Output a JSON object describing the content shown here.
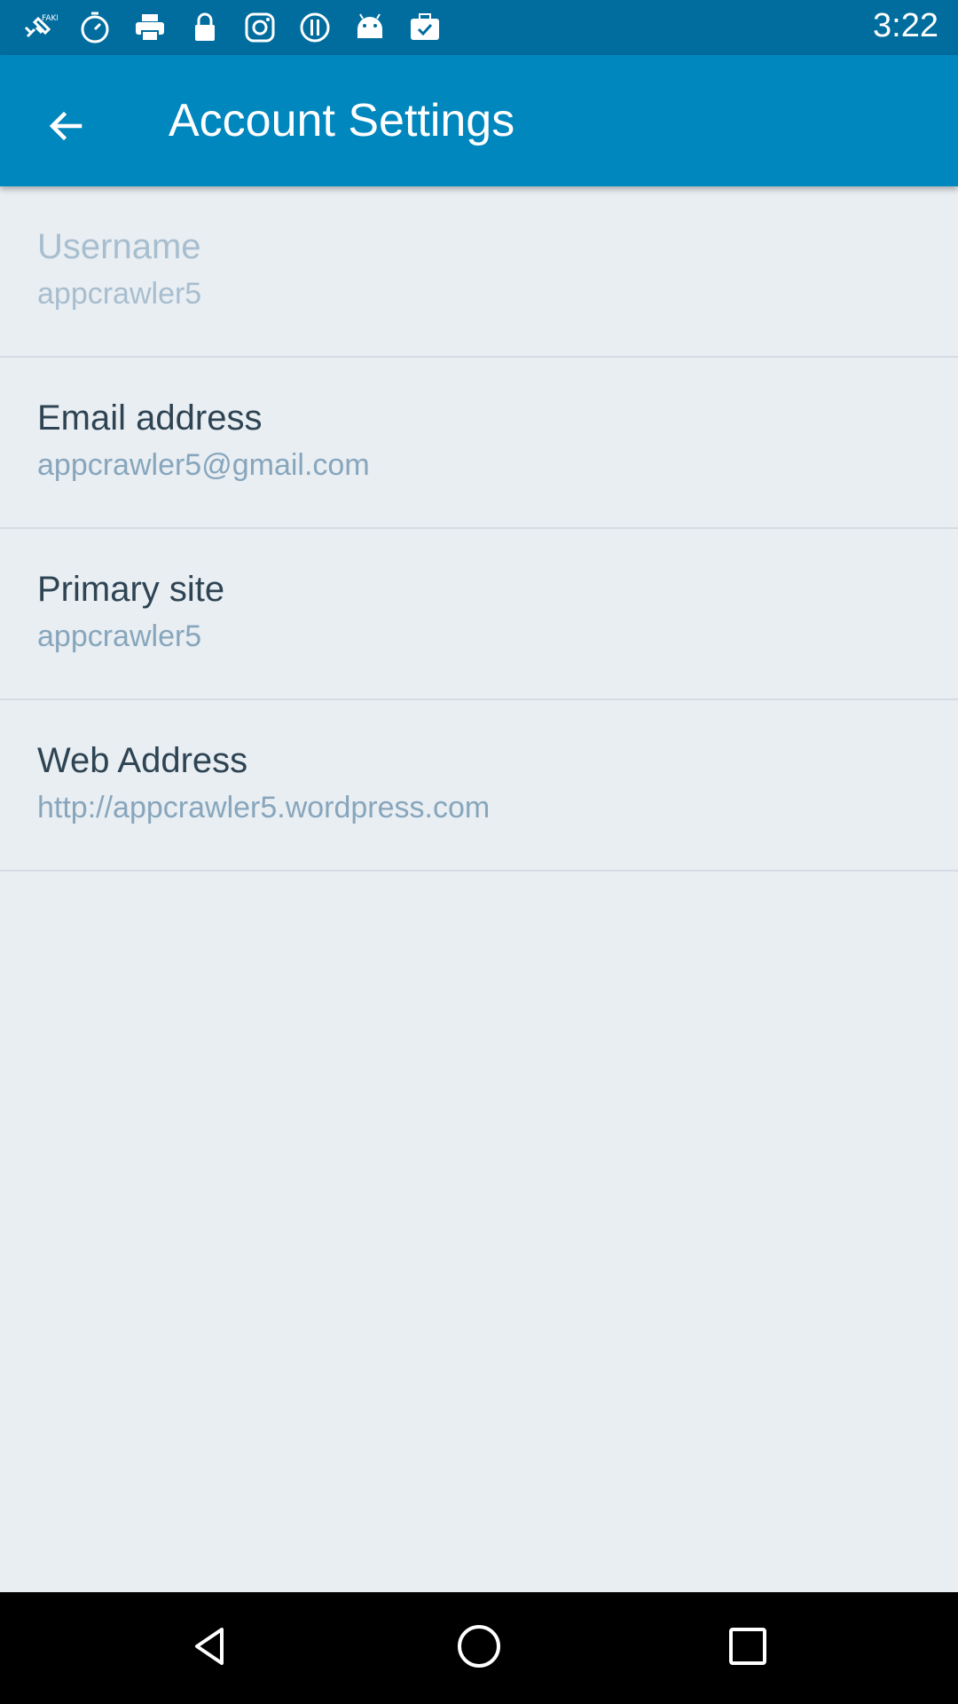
{
  "status_bar": {
    "time": "3:22",
    "icons": [
      "gps-fake-icon",
      "stopwatch-icon",
      "printer-icon",
      "lock-icon",
      "instagram-icon",
      "info-icon",
      "android-icon",
      "briefcase-check-icon"
    ]
  },
  "app_bar": {
    "title": "Account Settings",
    "back_icon": "arrow-left-icon",
    "background": "#0087be"
  },
  "settings": [
    {
      "label": "Username",
      "value": "appcrawler5",
      "enabled": false
    },
    {
      "label": "Email address",
      "value": "appcrawler5@gmail.com",
      "enabled": true
    },
    {
      "label": "Primary site",
      "value": "appcrawler5",
      "enabled": true
    },
    {
      "label": "Web Address",
      "value": "http://appcrawler5.wordpress.com",
      "enabled": true
    }
  ],
  "nav_bar": {
    "buttons": [
      "back-triangle-icon",
      "home-circle-icon",
      "recents-square-icon"
    ]
  }
}
